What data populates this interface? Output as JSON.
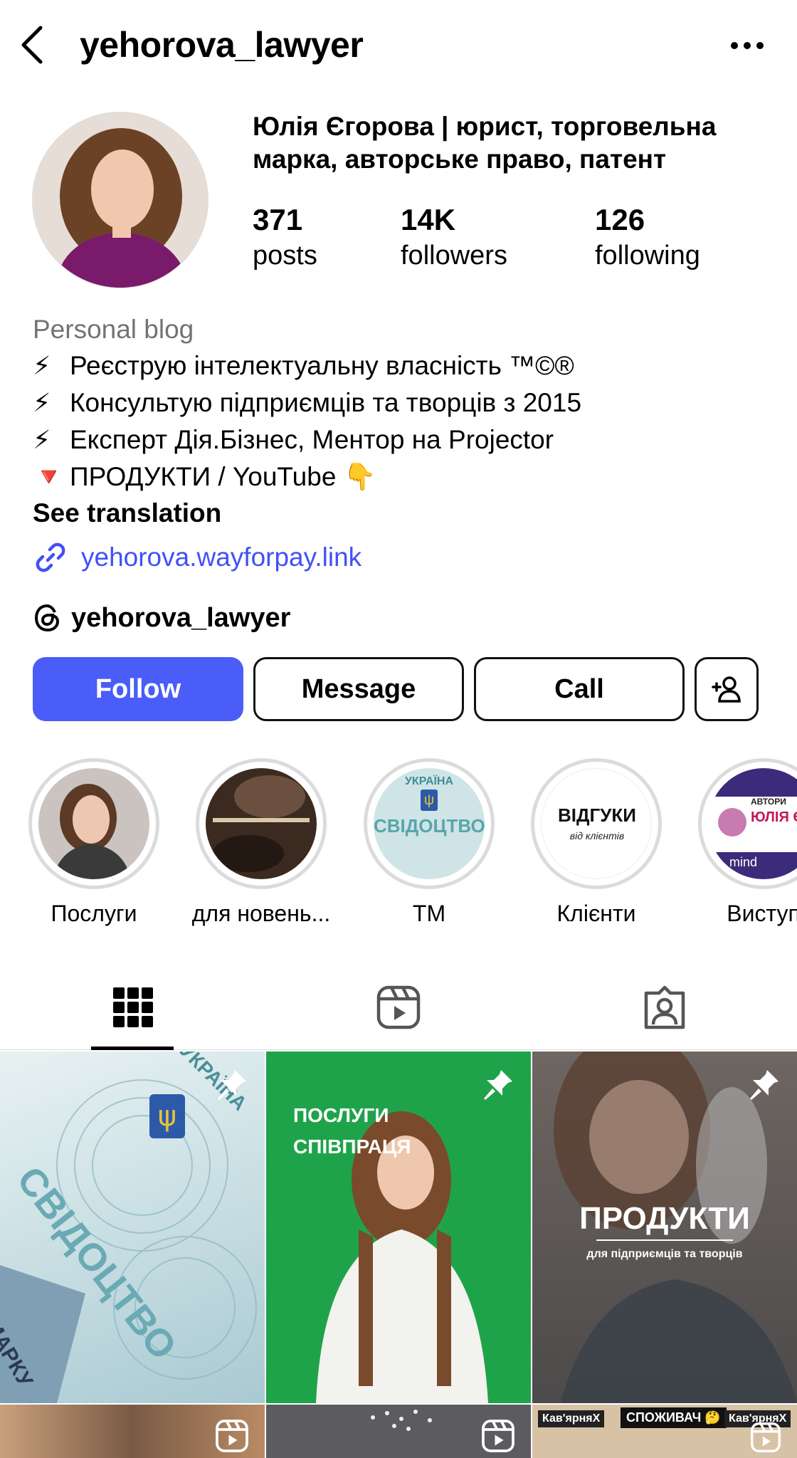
{
  "header": {
    "username": "yehorova_lawyer",
    "back_icon": "chevron-left-icon",
    "more_icon": "ellipsis-icon"
  },
  "profile": {
    "full_name": "Юлія Єгорова | юрист, торговельна марка, авторське право, патент",
    "stats": {
      "posts": {
        "value": "371",
        "label": "posts"
      },
      "followers": {
        "value": "14K",
        "label": "followers"
      },
      "following": {
        "value": "126",
        "label": "following"
      }
    }
  },
  "bio": {
    "category": "Personal blog",
    "lines": [
      {
        "icon": "⚡",
        "text": "Реєструю інтелектуальну власність ™©®"
      },
      {
        "icon": "⚡",
        "text": "Консультую підприємців та творців з 2015"
      },
      {
        "icon": "⚡",
        "text": "Експерт Дія.Бізнес, Ментор на Projector"
      },
      {
        "icon": "🔻",
        "text": "ПРОДУКТИ / YouTube 👇"
      }
    ],
    "see_translation": "See translation",
    "link": "yehorova.wayforpay.link",
    "threads_handle": "yehorova_lawyer"
  },
  "actions": {
    "follow": "Follow",
    "message": "Message",
    "call": "Call",
    "suggest_icon": "add-person-icon"
  },
  "highlights": [
    {
      "label": "Послуги"
    },
    {
      "label": "для новень..."
    },
    {
      "label": "ТМ",
      "image_text_top": "УКРАЇНА",
      "image_text": "СВІДОЦТВО"
    },
    {
      "label": "Клієнти",
      "image_text": "ВІДГУКИ",
      "image_subtext": "від клієнтів"
    },
    {
      "label": "Виступ",
      "image_text_top": "АВТОРИ",
      "image_text": "ЮЛІЯ ЄГ",
      "image_subtext": "mind"
    }
  ],
  "tabs": [
    {
      "name": "posts",
      "icon": "grid-icon",
      "active": true
    },
    {
      "name": "reels",
      "icon": "reels-icon",
      "active": false
    },
    {
      "name": "tagged",
      "icon": "tagged-icon",
      "active": false
    }
  ],
  "posts": [
    {
      "pinned": true,
      "text_top": "УКРАЇНА",
      "text": "СВІДОЦТВО",
      "text_side": "МАРКУ"
    },
    {
      "pinned": true,
      "text": "ПОСЛУГИ",
      "text2": "СПІВПРАЦЯ"
    },
    {
      "pinned": true,
      "text": "ПРОДУКТИ",
      "subtext": "для підприємців та творців"
    },
    {
      "reel": true
    },
    {
      "reel": true
    },
    {
      "reel": true,
      "labels": [
        "Кав'ярняХ",
        "СПОЖИВАЧ 🤔",
        "Кав'ярняХ"
      ]
    }
  ],
  "colors": {
    "accent": "#4a5df9",
    "link": "#4150f7",
    "muted": "#737373",
    "post2_bg": "#1fa34a"
  }
}
